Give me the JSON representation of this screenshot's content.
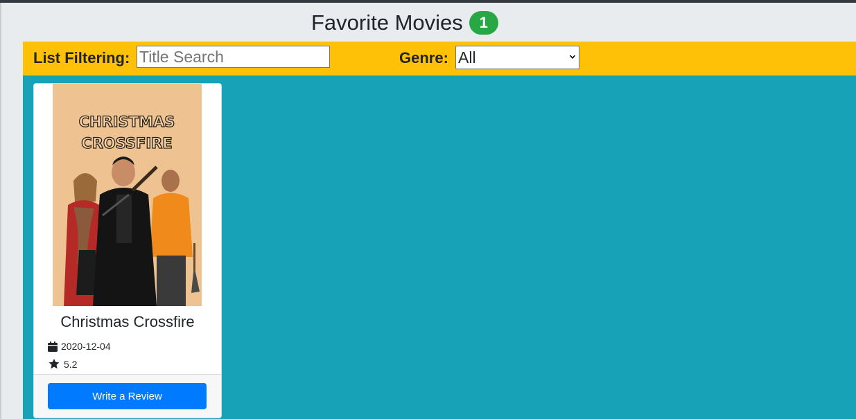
{
  "header": {
    "title": "Favorite Movies",
    "count": "1"
  },
  "filters": {
    "label": "List Filtering:",
    "search_placeholder": "Title Search",
    "search_value": "",
    "genre_label": "Genre:",
    "genre_selected": "All"
  },
  "movies": [
    {
      "poster_title_line1": "CHRISTMAS",
      "poster_title_line2": "CROSSFIRE",
      "title": "Christmas Crossfire",
      "release_date": "2020-12-04",
      "rating": "5.2",
      "action_label": "Write a Review"
    }
  ],
  "colors": {
    "badge": "#28a745",
    "filter_bar": "#ffc107",
    "content_bg": "#17a2b8",
    "button": "#007bff",
    "poster_bg": "#eec391"
  },
  "icons": {
    "date": "calendar-icon",
    "rating": "star-icon",
    "select": "chevron-down-icon"
  }
}
